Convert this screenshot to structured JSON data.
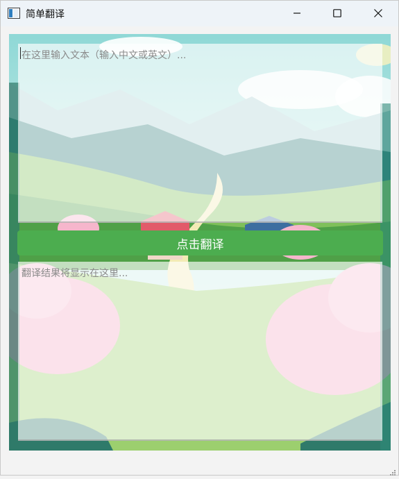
{
  "window": {
    "title": "简单翻译",
    "icon": "window-app-icon",
    "controls": [
      "minimize-icon",
      "maximize-icon",
      "close-icon"
    ]
  },
  "input": {
    "placeholder": "在这里输入文本（输入中文或英文）...",
    "value": ""
  },
  "translate_button": {
    "label": "点击翻译",
    "color": "#4cad4f"
  },
  "output": {
    "placeholder": "翻译结果将显示在这里...",
    "value": ""
  },
  "background": {
    "description_icon": "landscape-illustration"
  }
}
